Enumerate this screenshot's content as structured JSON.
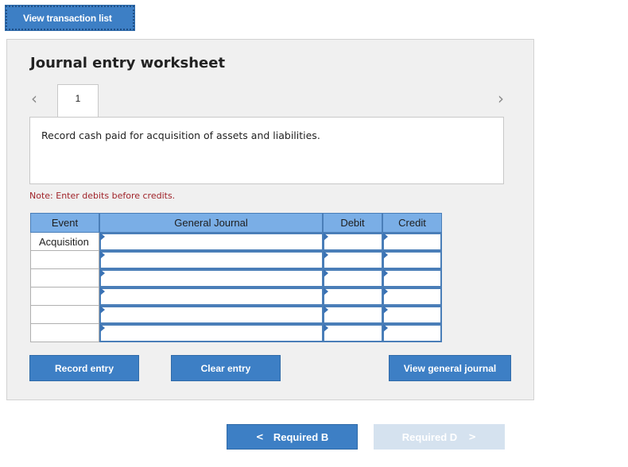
{
  "top_button": {
    "label": "View transaction list"
  },
  "worksheet": {
    "title": "Journal entry worksheet",
    "tabs": [
      {
        "label": "1"
      }
    ],
    "description": "Record cash paid for acquisition of assets and liabilities.",
    "note": "Note: Enter debits before credits.",
    "table": {
      "headers": {
        "event": "Event",
        "general_journal": "General Journal",
        "debit": "Debit",
        "credit": "Credit"
      },
      "rows": [
        {
          "event": "Acquisition",
          "account": "",
          "debit": "",
          "credit": ""
        },
        {
          "event": "",
          "account": "",
          "debit": "",
          "credit": ""
        },
        {
          "event": "",
          "account": "",
          "debit": "",
          "credit": ""
        },
        {
          "event": "",
          "account": "",
          "debit": "",
          "credit": ""
        },
        {
          "event": "",
          "account": "",
          "debit": "",
          "credit": ""
        },
        {
          "event": "",
          "account": "",
          "debit": "",
          "credit": ""
        }
      ]
    },
    "buttons": {
      "record": "Record entry",
      "clear": "Clear entry",
      "view_journal": "View general journal"
    }
  },
  "navigation": {
    "prev_label": "Required B",
    "next_label": "Required D",
    "prev_arrow": "<",
    "next_arrow": ">"
  },
  "icons": {
    "prev_tab": "chevron-left-icon",
    "next_tab": "chevron-right-icon"
  },
  "colors": {
    "button_blue": "#3d7fc5",
    "header_blue": "#7aaee6",
    "note_red": "#a0242a",
    "disabled_button": "#d5e2ef"
  }
}
